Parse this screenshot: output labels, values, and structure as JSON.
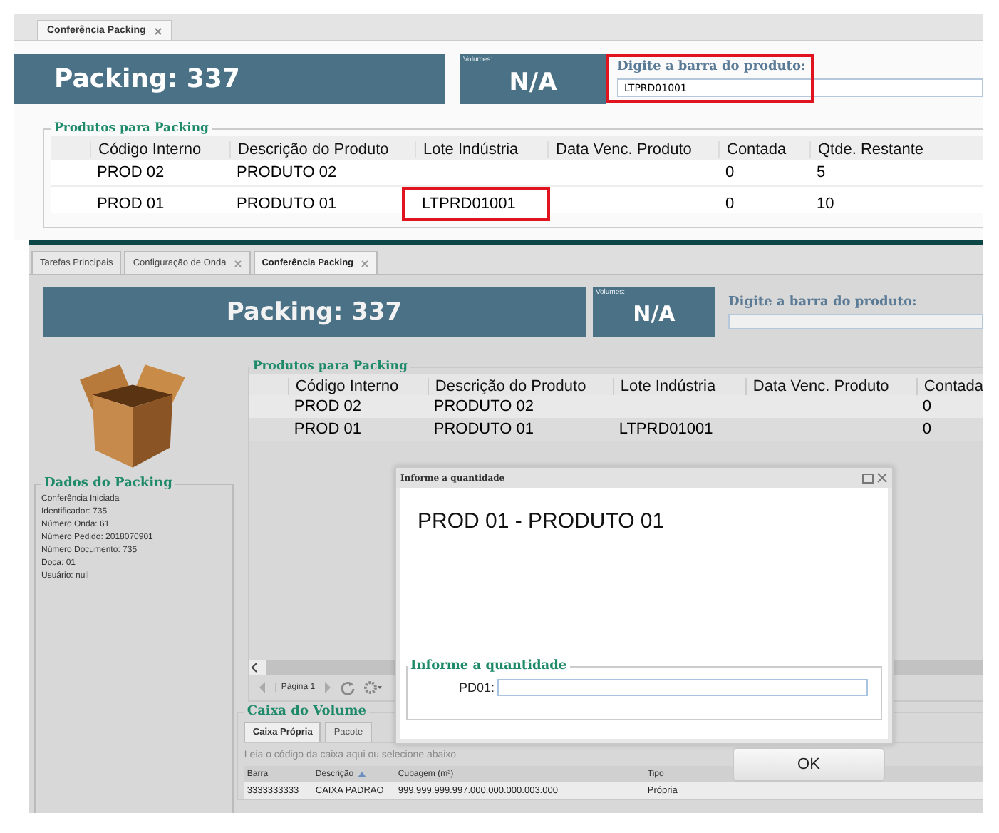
{
  "top": {
    "tabs": [
      {
        "label": "Conferência Packing",
        "selected": true,
        "closable": true
      }
    ],
    "header": {
      "title": "Packing: 337",
      "volumes_label": "Volumes:",
      "volumes_value": "N/A",
      "barcode_label": "Digite a barra do produto:",
      "barcode_value": "LTPRD01001",
      "highlighted": true
    },
    "products": {
      "legend": "Produtos para Packing",
      "columns": [
        "Código Interno",
        "Descrição do Produto",
        "Lote Indústria",
        "Data Venc. Produto",
        "Contada",
        "Qtde. Restante"
      ],
      "rows": [
        {
          "cells": [
            "PROD 02",
            "PRODUTO 02",
            "",
            "",
            "0",
            "5"
          ],
          "lot_highlighted": false
        },
        {
          "cells": [
            "PROD 01",
            "PRODUTO 01",
            "LTPRD01001",
            "",
            "0",
            "10"
          ],
          "lot_highlighted": true
        }
      ]
    }
  },
  "bottom": {
    "tabs": [
      {
        "label": "Tarefas Principais",
        "selected": false,
        "closable": false
      },
      {
        "label": "Configuração de Onda",
        "selected": false,
        "closable": true
      },
      {
        "label": "Conferência Packing",
        "selected": true,
        "closable": true
      }
    ],
    "header": {
      "title": "Packing: 337",
      "volumes_label": "Volumes:",
      "volumes_value": "N/A",
      "barcode_label": "Digite a barra do produto:"
    },
    "packing_data": {
      "legend": "Dados do Packing",
      "lines": [
        "Conferência Iniciada",
        "Identificador: 735",
        "Número Onda: 61",
        "Número Pedido: 2018070901",
        "Número Documento: 735",
        "Doca: 01",
        "Usuário: null"
      ]
    },
    "products": {
      "legend": "Produtos para Packing",
      "columns": [
        "Código Interno",
        "Descrição do Produto",
        "Lote Indústria",
        "Data Venc. Produto",
        "Contada"
      ],
      "rows": [
        {
          "cells": [
            "PROD 02",
            "PRODUTO 02",
            "",
            "",
            "0"
          ]
        },
        {
          "cells": [
            "PROD 01",
            "PRODUTO 01",
            "LTPRD01001",
            "",
            "0"
          ]
        }
      ],
      "pager": "Página 1"
    },
    "volume_box": {
      "legend": "Caixa do Volume",
      "tabs": [
        {
          "label": "Caixa Própria",
          "selected": true
        },
        {
          "label": "Pacote",
          "selected": false
        }
      ],
      "hint": "Leia o código da caixa aqui ou selecione abaixo",
      "columns": [
        "Barra",
        "Descrição",
        "Cubagem (m³)",
        "Tipo"
      ],
      "rows": [
        [
          "3333333333",
          "CAIXA PADRAO",
          "999.999.999.997.000.000.000.003.000",
          "Própria"
        ]
      ]
    },
    "dialog": {
      "title": "Informe a quantidade",
      "heading": "PROD 01 - PRODUTO 01",
      "legend": "Informe a quantidade",
      "field_label": "PD01:",
      "button": "OK"
    }
  }
}
